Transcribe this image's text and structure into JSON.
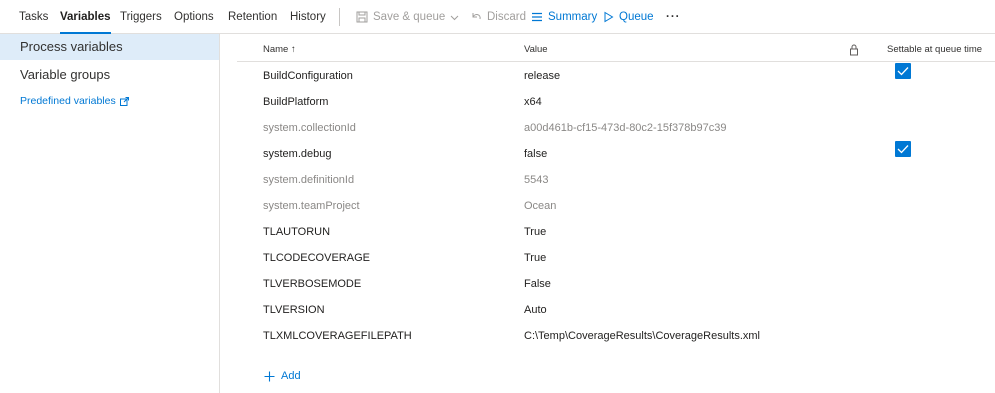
{
  "tabs": [
    {
      "label": "Tasks",
      "active": false
    },
    {
      "label": "Variables",
      "active": true
    },
    {
      "label": "Triggers",
      "active": false
    },
    {
      "label": "Options",
      "active": false
    },
    {
      "label": "Retention",
      "active": false
    },
    {
      "label": "History",
      "active": false
    }
  ],
  "toolbar": {
    "save_queue": {
      "label": "Save & queue",
      "icon": "save-icon",
      "disabled": true
    },
    "discard": {
      "label": "Discard",
      "icon": "undo-icon",
      "disabled": true
    },
    "summary": {
      "label": "Summary",
      "icon": "list-icon"
    },
    "queue": {
      "label": "Queue",
      "icon": "play-icon"
    },
    "more": "···"
  },
  "sidebar": {
    "items": [
      {
        "label": "Process variables",
        "selected": true
      },
      {
        "label": "Variable groups",
        "selected": false
      }
    ],
    "link": {
      "label": "Predefined variables",
      "icon": "external-link-icon"
    }
  },
  "table": {
    "columns": {
      "name": "Name ↑",
      "value": "Value",
      "lock_icon": "lock-icon",
      "settable": "Settable at queue time"
    },
    "rows": [
      {
        "name": "BuildConfiguration",
        "value": "release",
        "readonly": false,
        "settable": true
      },
      {
        "name": "BuildPlatform",
        "value": "x64",
        "readonly": false,
        "settable": false
      },
      {
        "name": "system.collectionId",
        "value": "a00d461b-cf15-473d-80c2-15f378b97c39",
        "readonly": true,
        "settable": false
      },
      {
        "name": "system.debug",
        "value": "false",
        "readonly": false,
        "settable": true
      },
      {
        "name": "system.definitionId",
        "value": "5543",
        "readonly": true,
        "settable": false
      },
      {
        "name": "system.teamProject",
        "value": "Ocean",
        "readonly": true,
        "settable": false
      },
      {
        "name": "TLAUTORUN",
        "value": "True",
        "readonly": false,
        "settable": false
      },
      {
        "name": "TLCODECOVERAGE",
        "value": "True",
        "readonly": false,
        "settable": false
      },
      {
        "name": "TLVERBOSEMODE",
        "value": "False",
        "readonly": false,
        "settable": false
      },
      {
        "name": "TLVERSION",
        "value": "Auto",
        "readonly": false,
        "settable": false
      },
      {
        "name": "TLXMLCOVERAGEFILEPATH",
        "value": "C:\\Temp\\CoverageResults\\CoverageResults.xml",
        "readonly": false,
        "settable": false
      }
    ]
  },
  "add_label": "Add",
  "colors": {
    "accent": "#0078d4",
    "selected_bg": "#deecf9",
    "muted": "#8a8886",
    "border": "#e1dfdd"
  }
}
